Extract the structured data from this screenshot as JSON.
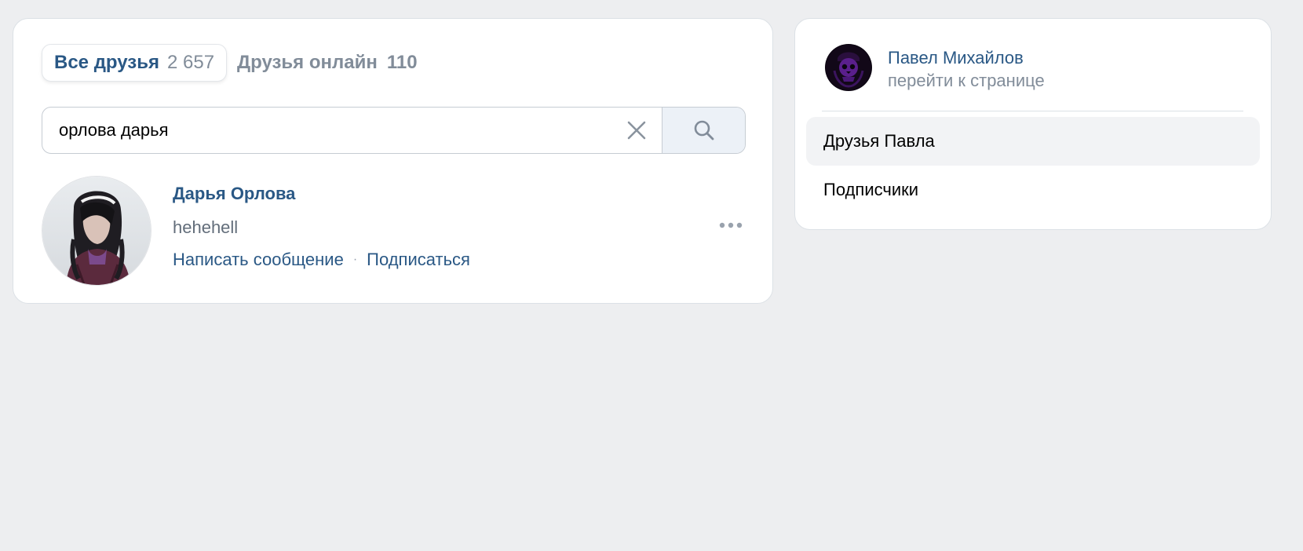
{
  "tabs": [
    {
      "label": "Все друзья",
      "count": "2 657",
      "active": true
    },
    {
      "label": "Друзья онлайн",
      "count": "110",
      "active": false
    }
  ],
  "search": {
    "value": "орлова дарья",
    "clear_icon": "close-icon",
    "search_icon": "search-icon"
  },
  "friend": {
    "name": "Дарья Орлова",
    "status": "hehehell",
    "actions": [
      "Написать сообщение",
      "Подписаться"
    ],
    "separator": "·",
    "more_icon": "more-horizontal-icon"
  },
  "profile": {
    "name": "Павел Михайлов",
    "subtitle": "перейти к странице"
  },
  "side_menu": [
    {
      "label": "Друзья Павла",
      "selected": true
    },
    {
      "label": "Подписчики",
      "selected": false
    }
  ],
  "colors": {
    "link": "#2a5885",
    "muted": "#818c99",
    "background": "#edeef0",
    "search_button": "#ecf1f7"
  }
}
